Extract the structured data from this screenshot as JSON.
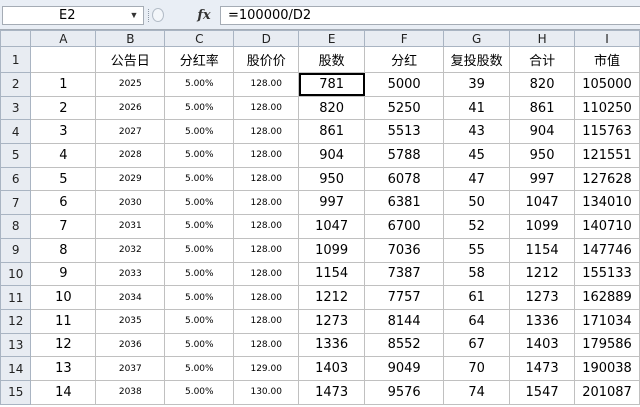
{
  "formula_bar": {
    "name_box": "E2",
    "fx_label": "fx",
    "formula": "=100000/D2"
  },
  "columns": [
    "A",
    "B",
    "C",
    "D",
    "E",
    "F",
    "G",
    "H",
    "I"
  ],
  "row_numbers": [
    "1",
    "2",
    "3",
    "4",
    "5",
    "6",
    "7",
    "8",
    "9",
    "10",
    "11",
    "12",
    "13",
    "14",
    "15"
  ],
  "header_row": [
    "",
    "公告日",
    "分红率",
    "股价价",
    "股数",
    "分红",
    "复投股数",
    "合计",
    "市值"
  ],
  "rows": [
    [
      "1",
      "2025",
      "5.00%",
      "128.00",
      "781",
      "5000",
      "39",
      "820",
      "105000"
    ],
    [
      "2",
      "2026",
      "5.00%",
      "128.00",
      "820",
      "5250",
      "41",
      "861",
      "110250"
    ],
    [
      "3",
      "2027",
      "5.00%",
      "128.00",
      "861",
      "5513",
      "43",
      "904",
      "115763"
    ],
    [
      "4",
      "2028",
      "5.00%",
      "128.00",
      "904",
      "5788",
      "45",
      "950",
      "121551"
    ],
    [
      "5",
      "2029",
      "5.00%",
      "128.00",
      "950",
      "6078",
      "47",
      "997",
      "127628"
    ],
    [
      "6",
      "2030",
      "5.00%",
      "128.00",
      "997",
      "6381",
      "50",
      "1047",
      "134010"
    ],
    [
      "7",
      "2031",
      "5.00%",
      "128.00",
      "1047",
      "6700",
      "52",
      "1099",
      "140710"
    ],
    [
      "8",
      "2032",
      "5.00%",
      "128.00",
      "1099",
      "7036",
      "55",
      "1154",
      "147746"
    ],
    [
      "9",
      "2033",
      "5.00%",
      "128.00",
      "1154",
      "7387",
      "58",
      "1212",
      "155133"
    ],
    [
      "10",
      "2034",
      "5.00%",
      "128.00",
      "1212",
      "7757",
      "61",
      "1273",
      "162889"
    ],
    [
      "11",
      "2035",
      "5.00%",
      "128.00",
      "1273",
      "8144",
      "64",
      "1336",
      "171034"
    ],
    [
      "12",
      "2036",
      "5.00%",
      "128.00",
      "1336",
      "8552",
      "67",
      "1403",
      "179586"
    ],
    [
      "13",
      "2037",
      "5.00%",
      "129.00",
      "1403",
      "9049",
      "70",
      "1473",
      "190038"
    ],
    [
      "14",
      "2038",
      "5.00%",
      "130.00",
      "1473",
      "9576",
      "74",
      "1547",
      "201087"
    ]
  ]
}
